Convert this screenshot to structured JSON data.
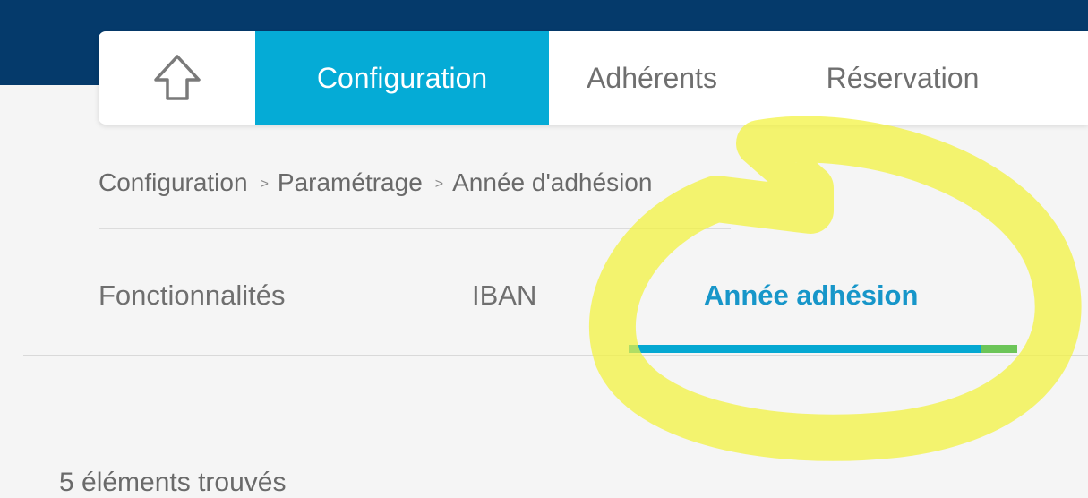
{
  "nav": {
    "home_icon": "home-arrow-up-icon",
    "tabs": [
      {
        "label": "Configuration",
        "active": true
      },
      {
        "label": "Adhérents",
        "active": false
      },
      {
        "label": "Réservation",
        "active": false
      }
    ]
  },
  "breadcrumb": {
    "items": [
      "Configuration",
      "Paramétrage",
      "Année d'adhésion"
    ],
    "separator": ">"
  },
  "subtabs": [
    {
      "label": "Fonctionnalités",
      "active": false
    },
    {
      "label": "IBAN",
      "active": false
    },
    {
      "label": "Année adhésion",
      "active": true
    }
  ],
  "content": {
    "partial_text": "5 éléments trouvés"
  },
  "colors": {
    "topbar": "#053a6b",
    "accent": "#05abd6",
    "active_subtab_text": "#1796c9",
    "highlight_marker": "#f0f02f"
  }
}
